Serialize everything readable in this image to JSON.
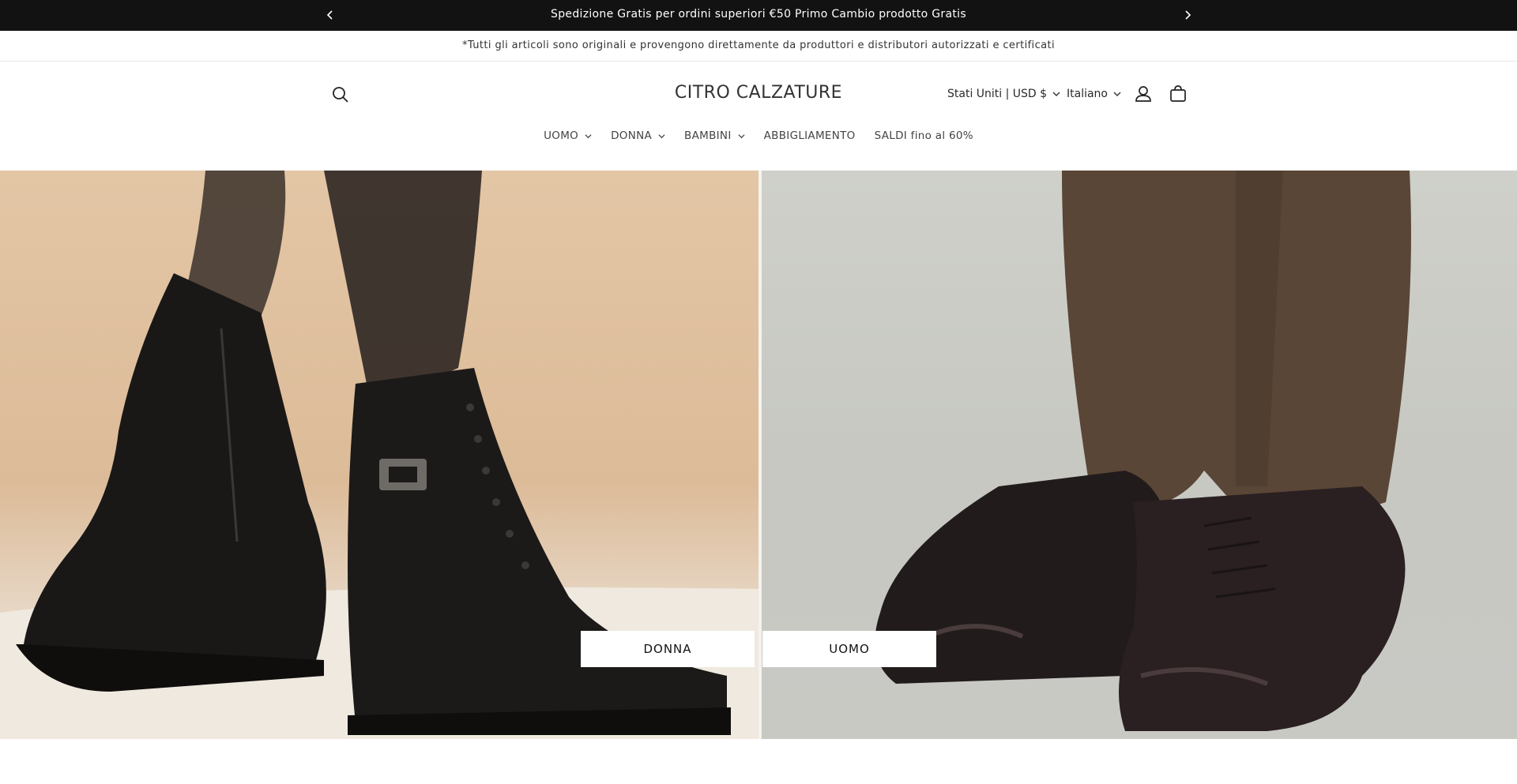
{
  "announcement": {
    "text": "Spedizione Gratis per ordini superiori €50 Primo Cambio prodotto Gratis",
    "prev_icon": "chevron-left-icon",
    "next_icon": "chevron-right-icon"
  },
  "notice": {
    "text": "*Tutti gli articoli sono originali e provengono direttamente da produttori e distributori autorizzati e certificati"
  },
  "header": {
    "logo": "CITRO CALZATURE",
    "country_selector": "Stati Uniti | USD $",
    "language_selector": "Italiano",
    "icons": [
      "search-icon",
      "account-icon",
      "cart-icon"
    ]
  },
  "nav": {
    "items": [
      {
        "label": "UOMO",
        "has_dropdown": true
      },
      {
        "label": "DONNA",
        "has_dropdown": true
      },
      {
        "label": "BAMBINI",
        "has_dropdown": true
      },
      {
        "label": "ABBIGLIAMENTO",
        "has_dropdown": false
      },
      {
        "label": "SALDI fino al 60%",
        "has_dropdown": false
      }
    ]
  },
  "hero": {
    "buttons": {
      "donna": "DONNA",
      "uomo": "UOMO"
    }
  },
  "colors": {
    "announcement_bg": "#121212",
    "text": "#121212",
    "hero_left_bg": "#dcbb98",
    "hero_right_bg": "#c7c8c2"
  }
}
